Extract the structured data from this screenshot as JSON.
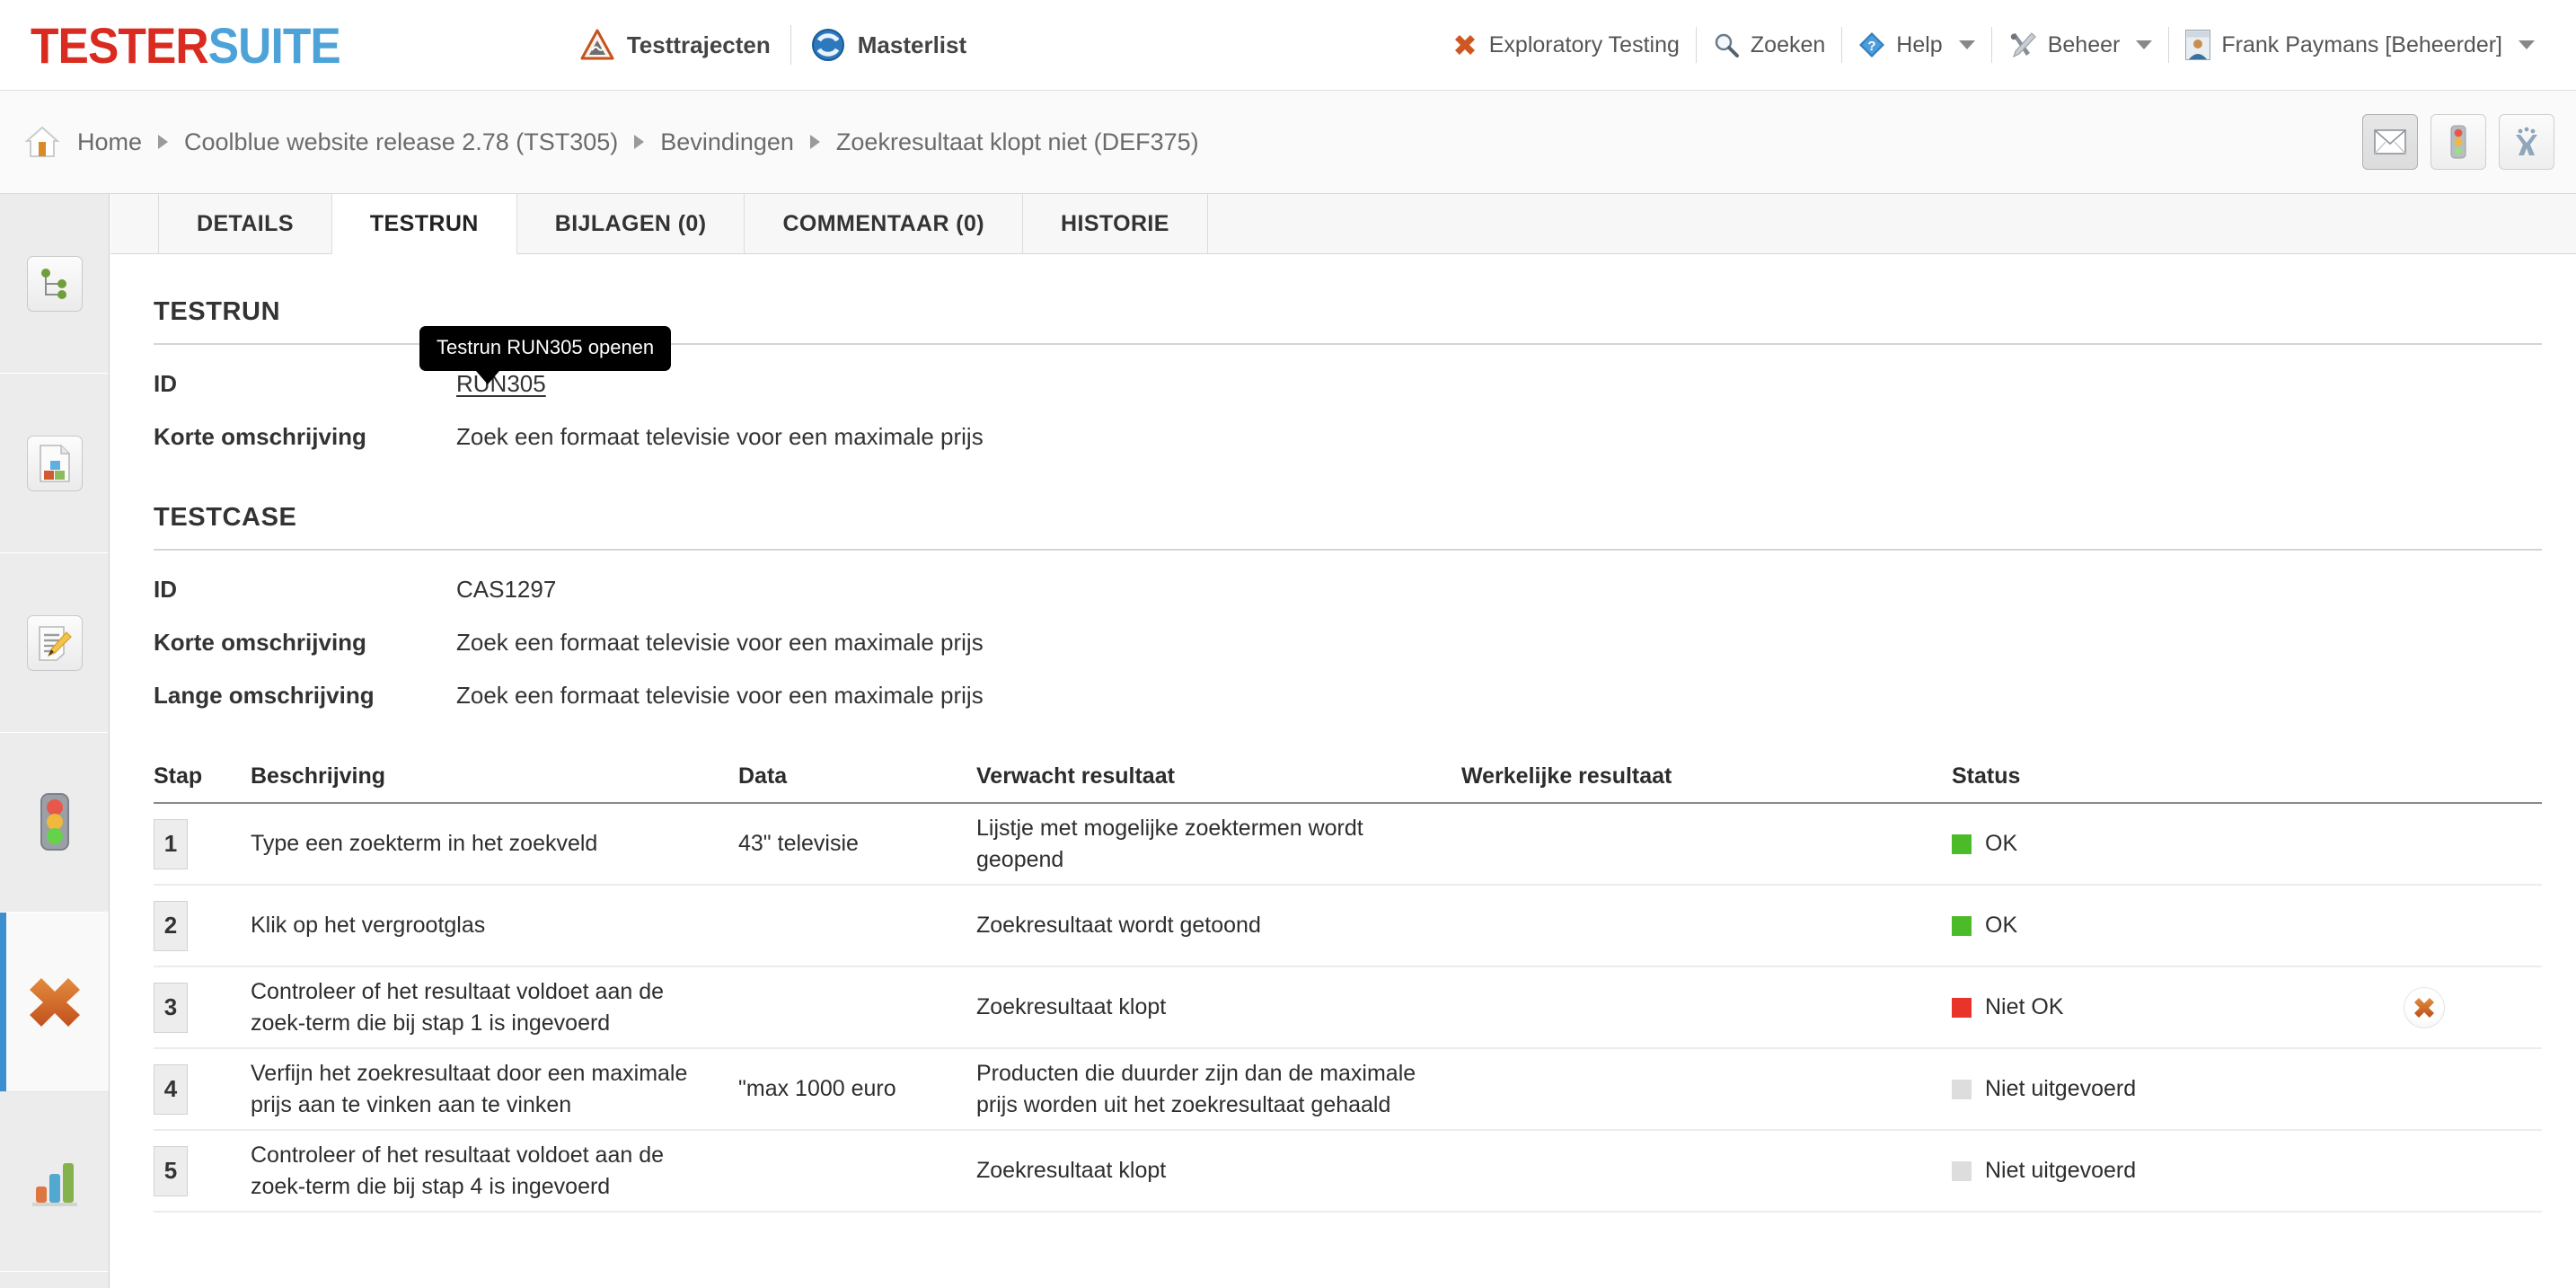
{
  "brand": {
    "part1": "TESTER",
    "part2": "SUITE",
    "color1": "#d92b1f",
    "color2": "#4da3d8"
  },
  "topnav": [
    {
      "label": "Testtrajecten",
      "icon": "warning-triangle-icon"
    },
    {
      "label": "Masterlist",
      "icon": "globe-refresh-icon"
    }
  ],
  "topright": [
    {
      "label": "Exploratory Testing",
      "icon": "orange-x-icon",
      "caret": false
    },
    {
      "label": "Zoeken",
      "icon": "magnifier-icon",
      "caret": false
    },
    {
      "label": "Help",
      "icon": "help-diamond-icon",
      "caret": true
    },
    {
      "label": "Beheer",
      "icon": "tools-icon",
      "caret": true
    },
    {
      "label": "Frank Paymans [Beheerder]",
      "icon": "user-avatar-icon",
      "caret": true
    }
  ],
  "breadcrumb": {
    "home_icon": "home-icon",
    "items": [
      "Home",
      "Coolblue website release 2.78 (TST305)",
      "Bevindingen",
      "Zoekresultaat klopt niet (DEF375)"
    ]
  },
  "breadcrumb_actions": [
    {
      "name": "envelope-icon",
      "active": true
    },
    {
      "name": "traffic-light-icon",
      "active": false
    },
    {
      "name": "exploratory-x-icon",
      "active": false
    }
  ],
  "sidebar": {
    "items": [
      {
        "name": "sitemap-icon",
        "selected": false,
        "boxed": true
      },
      {
        "name": "document-blocks-icon",
        "selected": false,
        "boxed": true
      },
      {
        "name": "document-edit-icon",
        "selected": false,
        "boxed": true
      },
      {
        "name": "traffic-light-icon",
        "selected": false,
        "boxed": false
      },
      {
        "name": "orange-x-icon",
        "selected": true,
        "boxed": false
      },
      {
        "name": "bar-chart-icon",
        "selected": false,
        "boxed": false
      }
    ]
  },
  "tabs": [
    {
      "label": "DETAILS",
      "active": false
    },
    {
      "label": "TESTRUN",
      "active": true
    },
    {
      "label": "BIJLAGEN (0)",
      "active": false
    },
    {
      "label": "COMMENTAAR (0)",
      "active": false
    },
    {
      "label": "HISTORIE",
      "active": false
    }
  ],
  "testrun": {
    "heading": "TESTRUN",
    "tooltip": "Testrun RUN305 openen",
    "fields": [
      {
        "label": "ID",
        "value": "RUN305",
        "link": true
      },
      {
        "label": "Korte omschrijving",
        "value": "Zoek een formaat televisie voor een maximale prijs",
        "link": false
      }
    ]
  },
  "testcase": {
    "heading": "TESTCASE",
    "fields": [
      {
        "label": "ID",
        "value": "CAS1297"
      },
      {
        "label": "Korte omschrijving",
        "value": "Zoek een formaat televisie voor een maximale prijs"
      },
      {
        "label": "Lange omschrijving",
        "value": "Zoek een formaat televisie voor een maximale prijs"
      }
    ]
  },
  "steps_table": {
    "columns": [
      "Stap",
      "Beschrijving",
      "Data",
      "Verwacht resultaat",
      "Werkelijke resultaat",
      "Status"
    ],
    "rows": [
      {
        "stap": "1",
        "beschrijving": "Type een zoekterm in het zoekveld",
        "data": "43\" televisie",
        "verwacht": "Lijstje met mogelijke zoektermen wordt geopend",
        "werkelijke": "",
        "status": "OK",
        "status_color": "#4cbb29",
        "action_icon": null
      },
      {
        "stap": "2",
        "beschrijving": "Klik op het vergrootglas",
        "data": "",
        "verwacht": "Zoekresultaat wordt getoond",
        "werkelijke": "",
        "status": "OK",
        "status_color": "#4cbb29",
        "action_icon": null
      },
      {
        "stap": "3",
        "beschrijving": "Controleer of het resultaat voldoet aan de zoek-term die bij stap 1 is ingevoerd",
        "data": "",
        "verwacht": "Zoekresultaat klopt",
        "werkelijke": "",
        "status": "Niet OK",
        "status_color": "#e8342a",
        "action_icon": "orange-x-circle-icon"
      },
      {
        "stap": "4",
        "beschrijving": "Verfijn het zoekresultaat door een maximale prijs aan te vinken aan te vinken",
        "data": "\"max 1000 euro",
        "verwacht": "Producten die duurder zijn dan de maximale prijs worden uit het zoekresultaat gehaald",
        "werkelijke": "",
        "status": "Niet uitgevoerd",
        "status_color": "#dddddd",
        "action_icon": null
      },
      {
        "stap": "5",
        "beschrijving": "Controleer of het resultaat voldoet aan de zoek-term die bij stap 4 is ingevoerd",
        "data": "",
        "verwacht": "Zoekresultaat klopt",
        "werkelijke": "",
        "status": "Niet uitgevoerd",
        "status_color": "#dddddd",
        "action_icon": null
      }
    ]
  }
}
